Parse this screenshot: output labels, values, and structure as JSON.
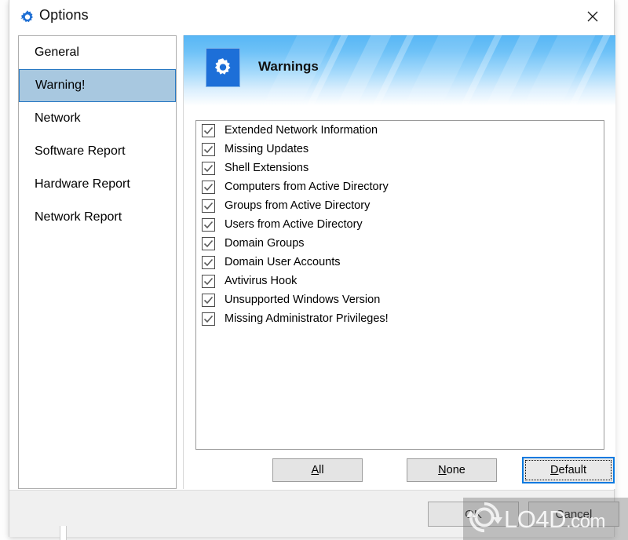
{
  "window": {
    "title": "Options",
    "title_icon": "gear-icon",
    "close_label": "✕"
  },
  "sidebar": {
    "items": [
      {
        "label": "General",
        "selected": false
      },
      {
        "label": "Warning!",
        "selected": true
      },
      {
        "label": "Network",
        "selected": false
      },
      {
        "label": "Software Report",
        "selected": false
      },
      {
        "label": "Hardware Report",
        "selected": false
      },
      {
        "label": "Network Report",
        "selected": false
      }
    ]
  },
  "banner": {
    "title": "Warnings",
    "icon": "gear-icon",
    "gradient_top": "#57b6f5",
    "gradient_bottom": "#ffffff",
    "icon_bg": "#1d6fd8"
  },
  "warnings_list": {
    "items": [
      {
        "label": "Extended Network Information",
        "checked": true
      },
      {
        "label": "Missing Updates",
        "checked": true
      },
      {
        "label": "Shell Extensions",
        "checked": true
      },
      {
        "label": "Computers from Active Directory",
        "checked": true
      },
      {
        "label": "Groups from Active Directory",
        "checked": true
      },
      {
        "label": "Users from Active Directory",
        "checked": true
      },
      {
        "label": "Domain Groups",
        "checked": true
      },
      {
        "label": "Domain User Accounts",
        "checked": true
      },
      {
        "label": "Avtivirus Hook",
        "checked": true
      },
      {
        "label": "Unsupported Windows Version",
        "checked": true
      },
      {
        "label": "Missing Administrator Privileges!",
        "checked": true
      }
    ]
  },
  "actions": {
    "all": {
      "accel": "A",
      "rest": "ll"
    },
    "none": {
      "accel": "N",
      "rest": "one"
    },
    "default": {
      "accel": "D",
      "rest": "efault",
      "focused": true
    }
  },
  "footer": {
    "ok_label": "OK",
    "cancel_label": "Cancel"
  },
  "watermark": {
    "text": "LO4D",
    "suffix": ".com"
  },
  "colors": {
    "selection_bg": "#a8c8e0",
    "selection_border": "#2a7ac4",
    "focus_blue": "#0a7ae0"
  }
}
